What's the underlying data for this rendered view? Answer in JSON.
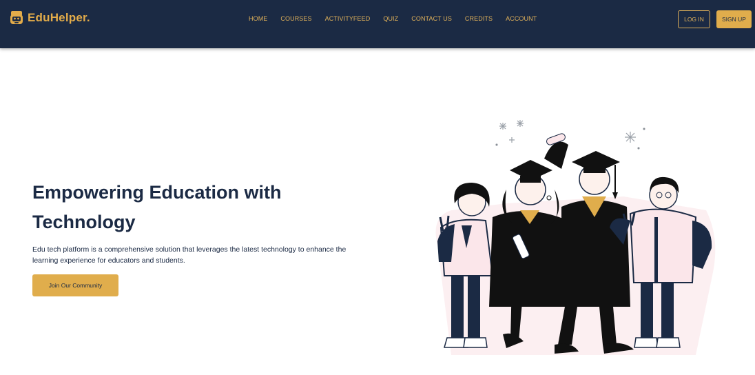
{
  "brand": {
    "name": "EduHelper.",
    "icon": "student-face-icon",
    "color": "#e3ac4a"
  },
  "nav": {
    "links": [
      "HOME",
      "COURSES",
      "ACTIVITYFEED",
      "QUIZ",
      "CONTACT US",
      "CREDITS",
      "ACCOUNT"
    ]
  },
  "auth": {
    "login_label": "LOG IN",
    "signup_label": "SIGN UP"
  },
  "hero": {
    "title": "Empowering Education with Technology",
    "description": "Edu tech platform is a comprehensive solution that leverages the latest technology to enhance the learning experience for educators and students.",
    "cta_label": "Join Our Community"
  },
  "illustration": {
    "subject": "graduates-group-illustration"
  },
  "colors": {
    "navy": "#1b2a44",
    "gold": "#e0ad4c",
    "white": "#ffffff",
    "pink": "#fbe6ea"
  }
}
